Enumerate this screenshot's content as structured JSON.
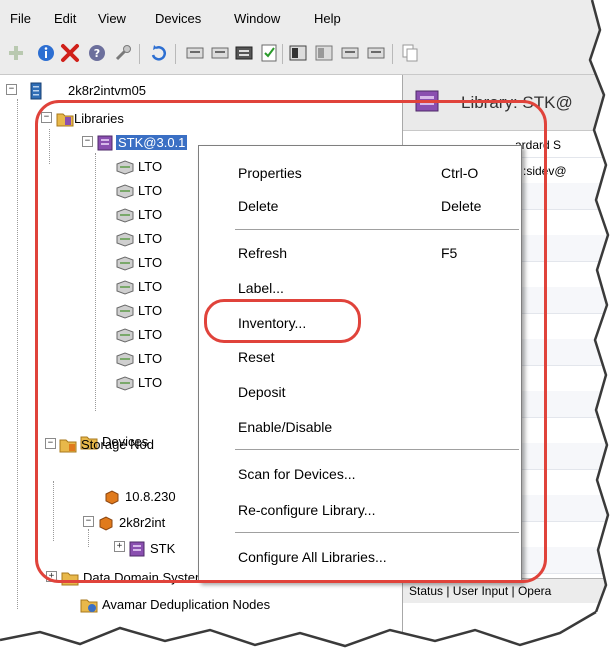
{
  "menubar": {
    "items": [
      "File",
      "Edit",
      "View",
      "Devices",
      "Window",
      "Help"
    ]
  },
  "toolbar": {
    "icons": [
      "add-icon",
      "info-icon",
      "delete-icon",
      "help-icon",
      "wrench-icon",
      "refresh-icon",
      "device-icon",
      "device-icon",
      "library-icon",
      "checklist-icon",
      "drive-icon",
      "drive-icon",
      "device-icon",
      "device-icon",
      "copy-icon"
    ]
  },
  "tree": {
    "root": "2k8r2intvm05",
    "libraries": "Libraries",
    "library": "STK@3.0.1",
    "drives": [
      "LTO",
      "LTO",
      "LTO",
      "LTO",
      "LTO",
      "LTO",
      "LTO",
      "LTO",
      "LTO",
      "LTO"
    ],
    "devices": "Devices",
    "storage_nodes": "Storage Nod",
    "node_ip": "10.8.230",
    "node_host": "2k8r2int",
    "node_lib": "STK",
    "data_domain": "Data Domain Systems",
    "avamar": "Avamar Deduplication Nodes"
  },
  "right_panel": {
    "title": "Library: STK@",
    "row1": "ardard S",
    "row2": ":sidev@",
    "status_tabs": "Status | User Input | Opera"
  },
  "context_menu": {
    "items": [
      {
        "label": "Properties",
        "shortcut": "Ctrl-O"
      },
      {
        "label": "Delete",
        "shortcut": "Delete"
      },
      {
        "label": "Refresh",
        "shortcut": "F5"
      },
      {
        "label": "Label...",
        "shortcut": ""
      },
      {
        "label": "Inventory...",
        "shortcut": ""
      },
      {
        "label": "Reset",
        "shortcut": ""
      },
      {
        "label": "Deposit",
        "shortcut": ""
      },
      {
        "label": "Enable/Disable",
        "shortcut": ""
      },
      {
        "label": "Scan for Devices...",
        "shortcut": ""
      },
      {
        "label": "Re-configure Library...",
        "shortcut": ""
      },
      {
        "label": "Configure All Libraries...",
        "shortcut": ""
      }
    ]
  },
  "colors": {
    "callout": "#e0433b",
    "selection": "#3a6fc4",
    "library_icon": "#8a4fb0",
    "folder_icon": "#e8b84a"
  }
}
